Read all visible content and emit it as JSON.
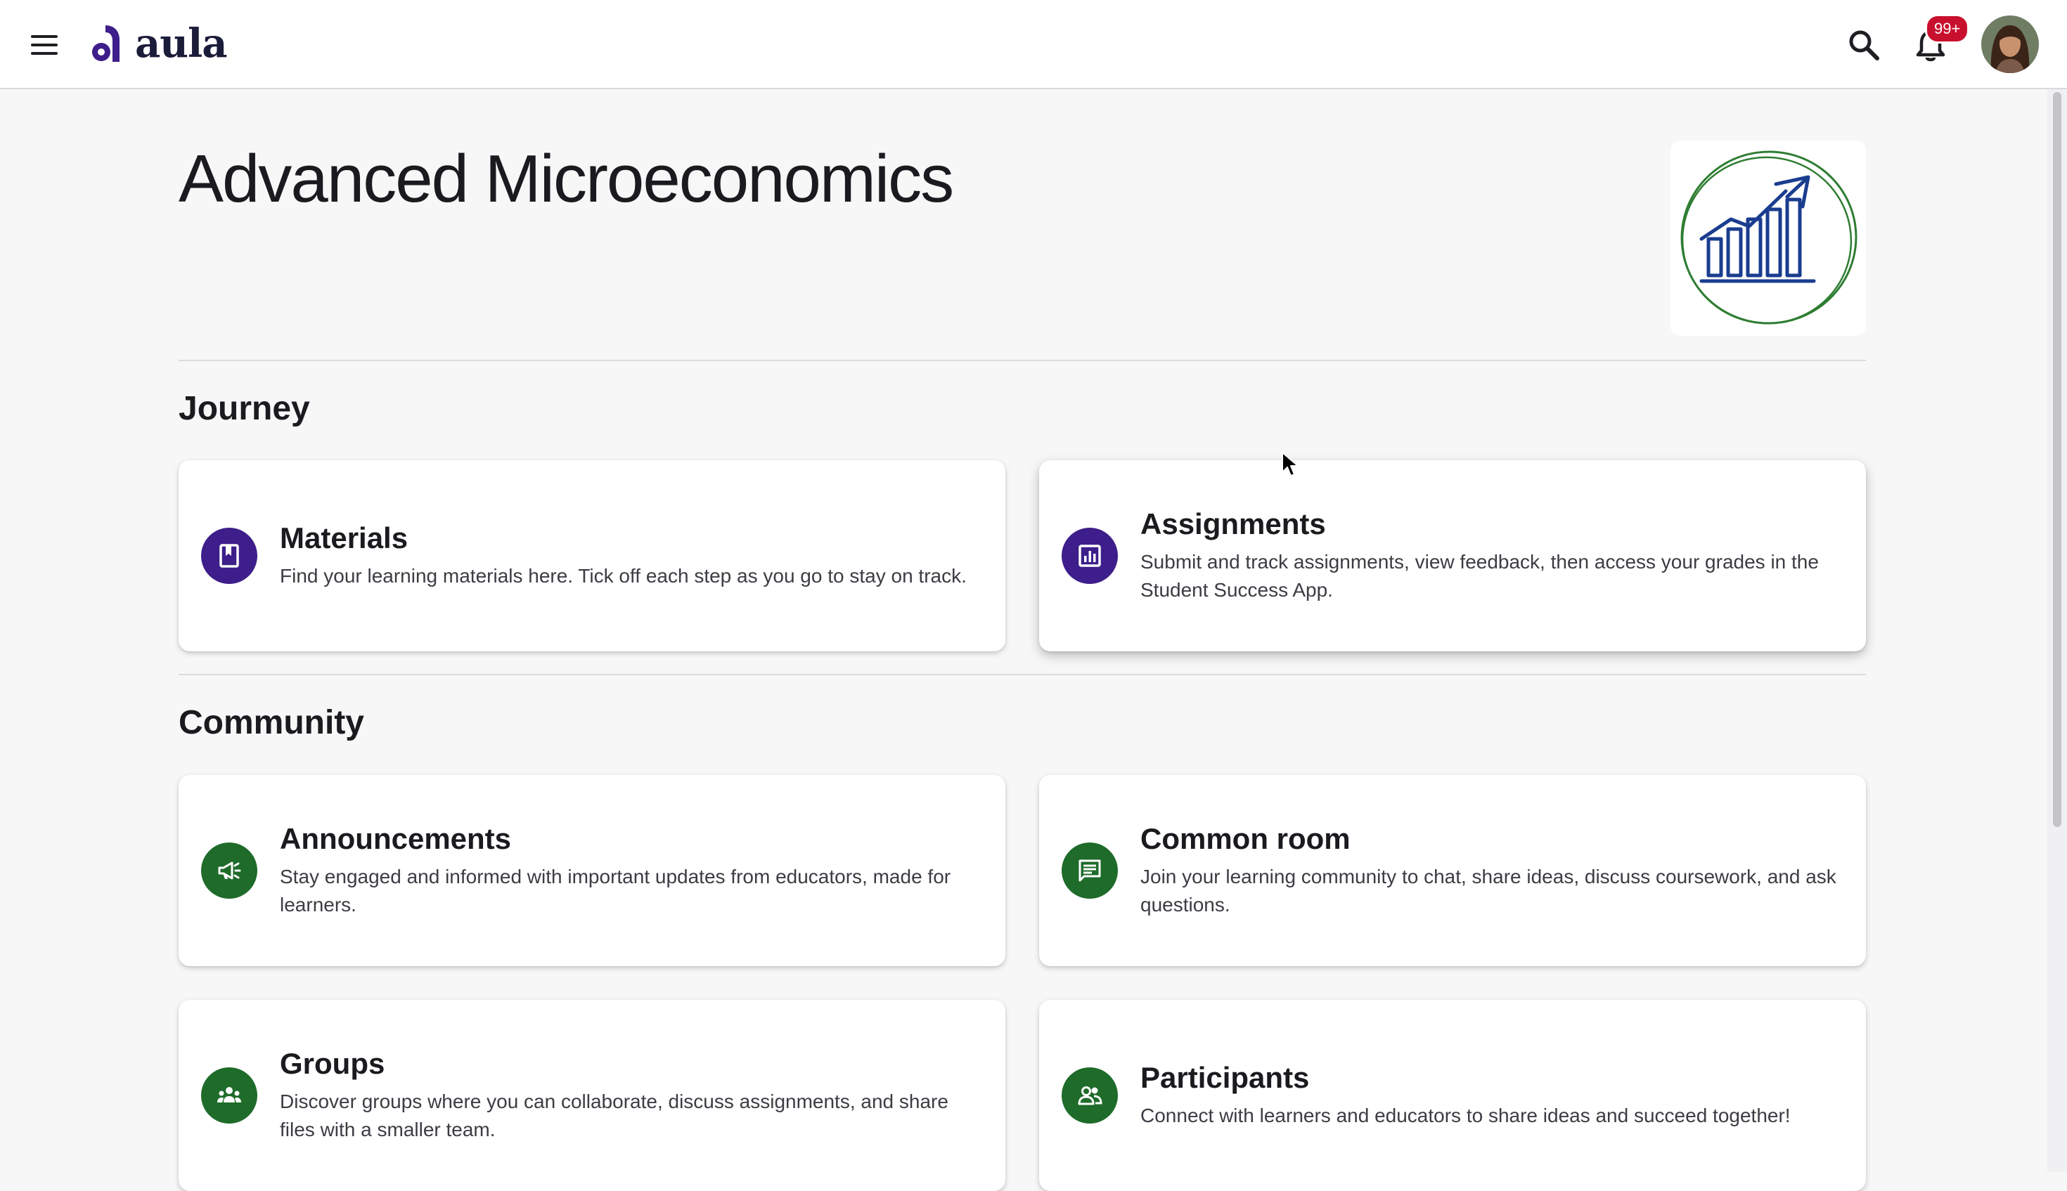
{
  "app": {
    "logo_text": "aula",
    "notification_badge": "99+"
  },
  "course": {
    "title": "Advanced Microeconomics"
  },
  "sections": {
    "journey": {
      "heading": "Journey",
      "cards": {
        "materials": {
          "title": "Materials",
          "description": "Find your learning materials here. Tick off each step as you go to stay on track.",
          "icon": "book-icon"
        },
        "assignments": {
          "title": "Assignments",
          "description": "Submit and track assignments, view feedback, then access your grades in the Student Success App.",
          "icon": "chart-box-icon"
        }
      }
    },
    "community": {
      "heading": "Community",
      "cards": {
        "announcements": {
          "title": "Announcements",
          "description": "Stay engaged and informed with important updates from educators, made for learners.",
          "icon": "megaphone-icon"
        },
        "common_room": {
          "title": "Common room",
          "description": "Join your learning community to chat, share ideas, discuss coursework, and ask questions.",
          "icon": "chat-icon"
        },
        "groups": {
          "title": "Groups",
          "description": "Discover groups where you can collaborate, discuss assignments, and share files with a smaller team.",
          "icon": "groups-icon"
        },
        "participants": {
          "title": "Participants",
          "description": "Connect with learners and educators to share ideas and succeed together!",
          "icon": "participants-icon"
        }
      }
    }
  },
  "colors": {
    "journey_icon_bg": "#3d1e8a",
    "community_icon_bg": "#1e6b2a",
    "brand_purple": "#3d1e8a",
    "badge_red": "#c8102e",
    "course_image_stroke": "#1a3d8f",
    "course_image_ring": "#2e7d32"
  }
}
